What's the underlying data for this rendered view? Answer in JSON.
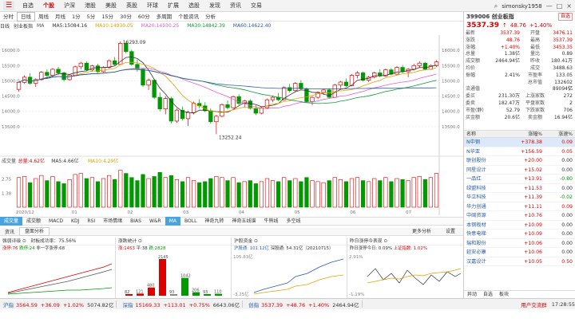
{
  "topbar": {
    "nav": [
      "自选",
      "个股",
      "沪深",
      "港股",
      "美股",
      "英股",
      "环球",
      "扩展",
      "选股",
      "发现",
      "资讯",
      "交易"
    ],
    "active_index": 1,
    "username": "simonsky1958",
    "controls": [
      "—",
      "□",
      "×"
    ]
  },
  "subbar": {
    "tabs": [
      "分时",
      "日线",
      "周线",
      "月线",
      "1分",
      "5分",
      "15分",
      "30分",
      "60分",
      "多周期",
      "个股资讯",
      "分析"
    ],
    "active_index": 1
  },
  "legend": {
    "period": "日线",
    "index": "创业板指",
    "items": [
      {
        "label": "MA",
        "color": "#555"
      },
      {
        "label": "MA5:15084.16",
        "color": "#333"
      },
      {
        "label": "MA10:14930.05",
        "color": "#e3a300"
      },
      {
        "label": "MA20:14930.25",
        "color": "#e35fd6"
      },
      {
        "label": "MA30:14842.39",
        "color": "#0a9a2d"
      },
      {
        "label": "MA60:14622.40",
        "color": "#2a5caa"
      }
    ]
  },
  "chart_data": {
    "type": "candlestick",
    "y_ticks": [
      "16000.0",
      "15500.0",
      "15000.0",
      "14500.0",
      "14000.0",
      "13500.0"
    ],
    "ylim": [
      13000,
      16500
    ],
    "x_ticks": [
      "2020/12",
      "01",
      "02",
      "03",
      "04",
      "05",
      "06",
      "07"
    ],
    "annotations": [
      "16293.09",
      "13252.24"
    ],
    "ohlc": [
      [
        14720,
        14980,
        14650,
        14950
      ],
      [
        14950,
        15180,
        14900,
        15120
      ],
      [
        15120,
        15250,
        14880,
        14920
      ],
      [
        14920,
        15080,
        14800,
        15040
      ],
      [
        15040,
        15320,
        15010,
        15280
      ],
      [
        15280,
        15380,
        15120,
        15180
      ],
      [
        15180,
        15420,
        15150,
        15380
      ],
      [
        15380,
        15460,
        15200,
        15260
      ],
      [
        15260,
        15300,
        14980,
        15040
      ],
      [
        15040,
        15220,
        15000,
        15190
      ],
      [
        15190,
        15500,
        15160,
        15460
      ],
      [
        15460,
        15620,
        15380,
        15580
      ],
      [
        15580,
        15640,
        15320,
        15360
      ],
      [
        15360,
        15520,
        15300,
        15490
      ],
      [
        15490,
        15560,
        15260,
        15300
      ],
      [
        15300,
        15480,
        15270,
        15440
      ],
      [
        15440,
        15700,
        15400,
        15660
      ],
      [
        15660,
        15780,
        15500,
        15540
      ],
      [
        15540,
        16293,
        15520,
        16230
      ],
      [
        16230,
        16280,
        15900,
        15960
      ],
      [
        15960,
        16020,
        15500,
        15540
      ],
      [
        15540,
        15700,
        15300,
        15380
      ],
      [
        15380,
        15420,
        14800,
        14860
      ],
      [
        14860,
        15080,
        14700,
        15020
      ],
      [
        15020,
        15060,
        14400,
        14460
      ],
      [
        14460,
        14620,
        14000,
        14080
      ],
      [
        14080,
        14500,
        13900,
        14420
      ],
      [
        14420,
        14480,
        13600,
        13680
      ],
      [
        13680,
        14100,
        13620,
        14040
      ],
      [
        14040,
        14160,
        13700,
        13760
      ],
      [
        13760,
        14020,
        13520,
        13960
      ],
      [
        13960,
        14320,
        13900,
        14260
      ],
      [
        14260,
        14400,
        14100,
        14180
      ],
      [
        14180,
        14300,
        13980,
        14020
      ],
      [
        14020,
        14100,
        13600,
        13660
      ],
      [
        13660,
        13880,
        13252,
        13840
      ],
      [
        13840,
        14260,
        13800,
        14220
      ],
      [
        14220,
        14360,
        14060,
        14120
      ],
      [
        14120,
        14520,
        14100,
        14480
      ],
      [
        14480,
        14560,
        14200,
        14260
      ],
      [
        14260,
        14380,
        14120,
        14340
      ],
      [
        14340,
        14400,
        14060,
        14100
      ],
      [
        14100,
        14200,
        13880,
        13940
      ],
      [
        13940,
        14160,
        13900,
        14120
      ],
      [
        14120,
        14420,
        14080,
        14380
      ],
      [
        14380,
        14520,
        14300,
        14460
      ],
      [
        14460,
        14600,
        14340,
        14380
      ],
      [
        14380,
        14820,
        14360,
        14780
      ],
      [
        14780,
        14900,
        14620,
        14680
      ],
      [
        14680,
        14960,
        14650,
        14920
      ],
      [
        14920,
        15020,
        14700,
        14740
      ],
      [
        14740,
        14780,
        14280,
        14320
      ],
      [
        14320,
        14500,
        14200,
        14460
      ],
      [
        14460,
        14660,
        14400,
        14620
      ],
      [
        14620,
        14740,
        14540,
        14700
      ],
      [
        14700,
        14760,
        14420,
        14460
      ],
      [
        14460,
        14900,
        14440,
        14860
      ],
      [
        14860,
        15000,
        14760,
        14960
      ],
      [
        14960,
        15080,
        14800,
        14840
      ],
      [
        14840,
        15220,
        14820,
        15180
      ],
      [
        15180,
        15320,
        15080,
        15260
      ],
      [
        15260,
        15300,
        14980,
        15020
      ],
      [
        15020,
        15160,
        14960,
        15120
      ],
      [
        15120,
        15300,
        15080,
        15260
      ],
      [
        15260,
        15380,
        15120,
        15160
      ],
      [
        15160,
        15400,
        15140,
        15360
      ],
      [
        15360,
        15420,
        15180,
        15220
      ],
      [
        15220,
        15480,
        15200,
        15440
      ],
      [
        15440,
        15520,
        15260,
        15300
      ],
      [
        15300,
        15420,
        15120,
        15380
      ],
      [
        15380,
        15560,
        15340,
        15500
      ],
      [
        15500,
        15640,
        15420,
        15580
      ],
      [
        15580,
        15620,
        15340,
        15380
      ],
      [
        15380,
        15540,
        15360,
        15500
      ],
      [
        15500,
        15680,
        15460,
        15620
      ]
    ],
    "volume_ylim": [
      0,
      4.2
    ],
    "volume_ticks": [
      "2.75",
      "1.38"
    ],
    "volume": [
      2.9,
      3.0,
      2.4,
      2.8,
      3.1,
      2.6,
      3.0,
      2.5,
      2.3,
      2.7,
      3.2,
      3.3,
      2.8,
      2.9,
      2.5,
      2.8,
      3.1,
      2.7,
      3.6,
      3.3,
      2.9,
      2.6,
      3.2,
      2.8,
      3.0,
      3.4,
      2.9,
      3.1,
      2.7,
      2.5,
      2.9,
      2.6,
      2.4,
      2.5,
      2.8,
      3.0,
      2.9,
      2.6,
      2.9,
      2.4,
      2.5,
      2.6,
      2.3,
      2.5,
      2.8,
      2.6,
      2.5,
      2.9,
      2.6,
      2.8,
      2.5,
      2.9,
      2.6,
      2.5,
      2.4,
      2.6,
      2.9,
      2.7,
      2.5,
      2.8,
      2.9,
      2.6,
      2.5,
      2.8,
      2.6,
      2.9,
      2.5,
      2.8,
      2.7,
      2.6,
      2.9,
      3.0,
      2.7,
      2.9,
      3.3
    ],
    "volume_legend": [
      {
        "label": "成交量",
        "color": "#555"
      },
      {
        "label": "总量:4.62亿",
        "color": "#d00"
      },
      {
        "label": "MA5:4.66亿",
        "color": "#333"
      },
      {
        "label": "MA10:4.29亿",
        "color": "#e3a300"
      }
    ]
  },
  "tabs_row": [
    "成交量",
    "成交额",
    "MACD",
    "KDJ",
    "RSI",
    "市场情绪",
    "BIAS",
    "W&R",
    "MA",
    "BOLL",
    "神奇九转",
    "神奇五线谱",
    "牛熊线",
    "多空线"
  ],
  "tabs_row_active": [
    0,
    8
  ],
  "panel_header": {
    "tabs": [
      "资讯",
      "盘面分析"
    ],
    "active_index": 1,
    "right": [
      "更多分析",
      "设置"
    ]
  },
  "subpanels": [
    {
      "title": "强弱评级 ⊙",
      "title2": "封板成功率：75.56%",
      "legend": [
        "涨停:76",
        "跌停:24",
        "非一字涨停:68"
      ]
    },
    {
      "title": "涨跌统计 ⊙",
      "legend": [
        "涨:1453",
        "平:38",
        "跌:2828"
      ],
      "bars": [
        82,
        121,
        480,
        2145,
        93,
        1042,
        206,
        93,
        110
      ],
      "bar_labels": [
        "82",
        "121",
        "480",
        "2145",
        "93",
        "1042",
        "206",
        "93",
        "110"
      ]
    },
    {
      "title": "沪股资金 ⊙",
      "legend": [
        "沪股通: 101.12亿",
        "深股通: 54.31亿（20210715）"
      ],
      "ylabels": [
        "105.83亿",
        "-3.25亿"
      ]
    },
    {
      "title": "昨日涨停今表现 ⊙",
      "legend": [
        "昨日涨停今日: 0.09%",
        "上证指数: 1.02%"
      ],
      "ylabels": [
        "2.91%",
        "-1.19%"
      ]
    }
  ],
  "rightpane": {
    "code": "399006",
    "name": "创业板指",
    "add_label": "自选",
    "price": "3537.39",
    "change_arrow": "↑",
    "change": "48.76",
    "pct": "+1.40%",
    "stats": [
      [
        "最新",
        "3537.39",
        "开盘",
        "3476.11"
      ],
      [
        "涨跌",
        "48.76",
        "最高",
        "3537.39"
      ],
      [
        "涨幅",
        "+1.40%",
        "最低",
        "3453.35"
      ],
      [
        "总量",
        "1.38亿",
        "量比",
        "0.89"
      ],
      [
        "成交额",
        "2464.94亿",
        "昨收",
        "180.41万"
      ],
      [
        "均价",
        "",
        "成交",
        "3488.63"
      ],
      [
        "振幅",
        "2.41%",
        "市盈率",
        "133.05"
      ],
      [
        "",
        "",
        "总市值",
        "132602亿"
      ],
      [
        "流通值",
        "",
        "",
        "89094亿"
      ],
      [
        "委买",
        "231.30万",
        "上涨家数",
        "272"
      ],
      [
        "委卖",
        "182.47万",
        "平盘家数",
        "2"
      ],
      [
        "市盈(静)",
        "52.79",
        "下跌家数",
        "706"
      ],
      [
        "买金额",
        "20.6亿",
        "卖金额",
        "16.94亿"
      ]
    ],
    "list_header": [
      "名称",
      "涨幅%",
      "涨速%"
    ],
    "stocks": [
      {
        "name": "N中钢",
        "chg": "+378.38",
        "spd": "0.09"
      },
      {
        "name": "N华亚",
        "chg": "+156.59",
        "spd": "0.05"
      },
      {
        "name": "联创股份",
        "chg": "+20.00",
        "spd": "0.00"
      },
      {
        "name": "同星设计",
        "chg": "+15.02",
        "spd": "0.00"
      },
      {
        "name": "一品红",
        "chg": "+13.91",
        "spd": "-0.80"
      },
      {
        "name": "绿盟科技",
        "chg": "+11.53",
        "spd": "0.00"
      },
      {
        "name": "华立科技",
        "chg": "+11.39",
        "spd": "-0.02"
      },
      {
        "name": "华力创通",
        "chg": "+11.11",
        "spd": "0.09"
      },
      {
        "name": "中闽资源",
        "chg": "+10.76",
        "spd": "0.00"
      },
      {
        "name": "本钢板材",
        "chg": "+10.09",
        "spd": "0.00"
      },
      {
        "name": "快意电梯",
        "chg": "+10.09",
        "spd": "0.00"
      },
      {
        "name": "瑞和股份",
        "chg": "+10.06",
        "spd": "0.00"
      },
      {
        "name": "延安必康",
        "chg": "+10.06",
        "spd": "0.00"
      },
      {
        "name": "汉嘉设计",
        "chg": "+10.05",
        "spd": "0.50"
      }
    ],
    "bottom_tabs": [
      "异动",
      "自选",
      "板块"
    ]
  },
  "bottombar": {
    "indices": [
      {
        "name": "沪指",
        "value": "3564.59",
        "chg": "+36.09",
        "pct": "+1.02%",
        "amt": "5074.82亿"
      },
      {
        "name": "深指",
        "value": "15169.33",
        "chg": "+113.01",
        "pct": "+0.75%",
        "amt": "6643.06亿"
      },
      {
        "name": "创指",
        "value": "3537.39",
        "chg": "+48.76",
        "pct": "+1.40%",
        "amt": "2464.94亿"
      }
    ],
    "right_text": "用户交流群",
    "time": "17:28:55"
  }
}
